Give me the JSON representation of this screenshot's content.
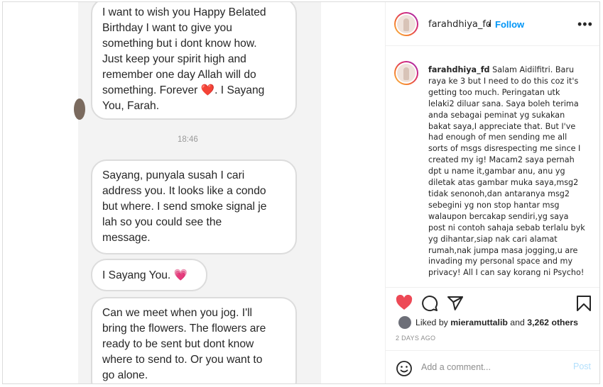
{
  "media": {
    "bubbles": [
      {
        "text": "I want to wish you Happy Belated\nBirthday I want to give you\nsomething but i dont know how.\nJust keep your spirit high and\nremember one day Allah will do\nsomething. Forever",
        "emoji": "❤️",
        "tail": ". I Sayang\nYou, Farah."
      },
      {
        "text": "Sayang, punyala susah I cari\naddress you. It looks like a condo\nbut where. I send smoke signal je\nlah so you could see the\nmessage."
      },
      {
        "text": "I Sayang You.",
        "emoji": "💗"
      },
      {
        "text": "Can we meet when you jog. I'll\nbring the flowers. The flowers are\nready to be sent but dont know\nwhere to send to. Or you want to\ngo alone."
      }
    ],
    "timestamp": "18:46"
  },
  "header": {
    "username": "farahdhiya_fd",
    "separator": "•",
    "follow_label": "Follow",
    "more_icon": "more-icon"
  },
  "caption": {
    "username": "farahdhiya_fd",
    "text": "Salam Aidilfitri. Baru raya ke 3 but I need to do this coz it's getting too much. Peringatan utk lelaki2 diluar sana. Saya boleh terima anda sebagai peminat yg sukakan bakat saya,I appreciate that. But I've had enough of men sending me all sorts of msgs disrespecting me since I created my ig! Macam2 saya pernah dpt u name it,gambar anu, anu yg diletak atas gambar muka saya,msg2 tidak senonoh,dan antaranya msg2 sebegini yg non stop hantar msg walaupon bercakap sendiri,yg saya post ni contoh sahaja sebab terlalu byk yg dihantar,siap nak cari alamat rumah,nak jumpa masa jogging,u are invading my personal space and my privacy! All I can say korang ni Psycho!"
  },
  "actions": {
    "liked": true,
    "like_color": "#ed4956",
    "icons": [
      "heart-icon",
      "comment-icon",
      "share-icon",
      "bookmark-icon"
    ]
  },
  "likes": {
    "prefix": "Liked by",
    "user": "mieramuttalib",
    "middle": "and",
    "others": "3,262 others"
  },
  "date": "2 DAYS AGO",
  "comment": {
    "placeholder": "Add a comment...",
    "post_label": "Post"
  },
  "colors": {
    "accent": "#0095f6",
    "post_disabled": "#b2dffc",
    "border": "#dbdbdb"
  }
}
